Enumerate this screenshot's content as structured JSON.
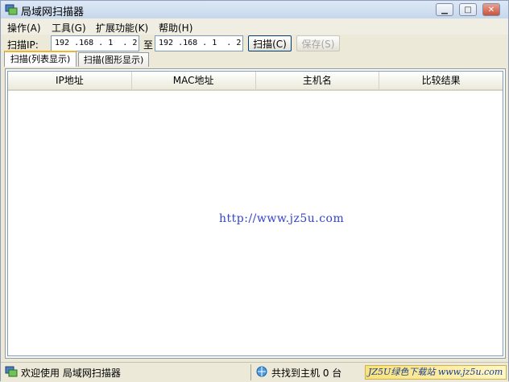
{
  "window": {
    "title": "局域网扫描器"
  },
  "menu": [
    {
      "label": "操作(A)"
    },
    {
      "label": "工具(G)"
    },
    {
      "label": "扩展功能(K)"
    },
    {
      "label": "帮助(H)"
    }
  ],
  "scan": {
    "label": "扫描IP:",
    "start_ip": "192 .168 . 1  . 2",
    "to_label": "至",
    "end_ip": "192 .168 . 1  . 2",
    "scan_button": "扫描(C)",
    "save_button": "保存(S)"
  },
  "tabs": [
    {
      "label": "扫描(列表显示)",
      "active": true
    },
    {
      "label": "扫描(图形显示)",
      "active": false
    }
  ],
  "table": {
    "columns": [
      "IP地址",
      "MAC地址",
      "主机名",
      "比较结果"
    ]
  },
  "watermark": "http://www.jz5u.com",
  "status": {
    "welcome": "欢迎使用 局域网扫描器",
    "count": "共找到主机 0 台",
    "promo": "JZ5U绿色下载站 www.jz5u.com"
  },
  "colors": {
    "title_gradient": "#C7D7EC",
    "tab_highlight": "#F4B42B",
    "watermark": "#3344CC"
  }
}
